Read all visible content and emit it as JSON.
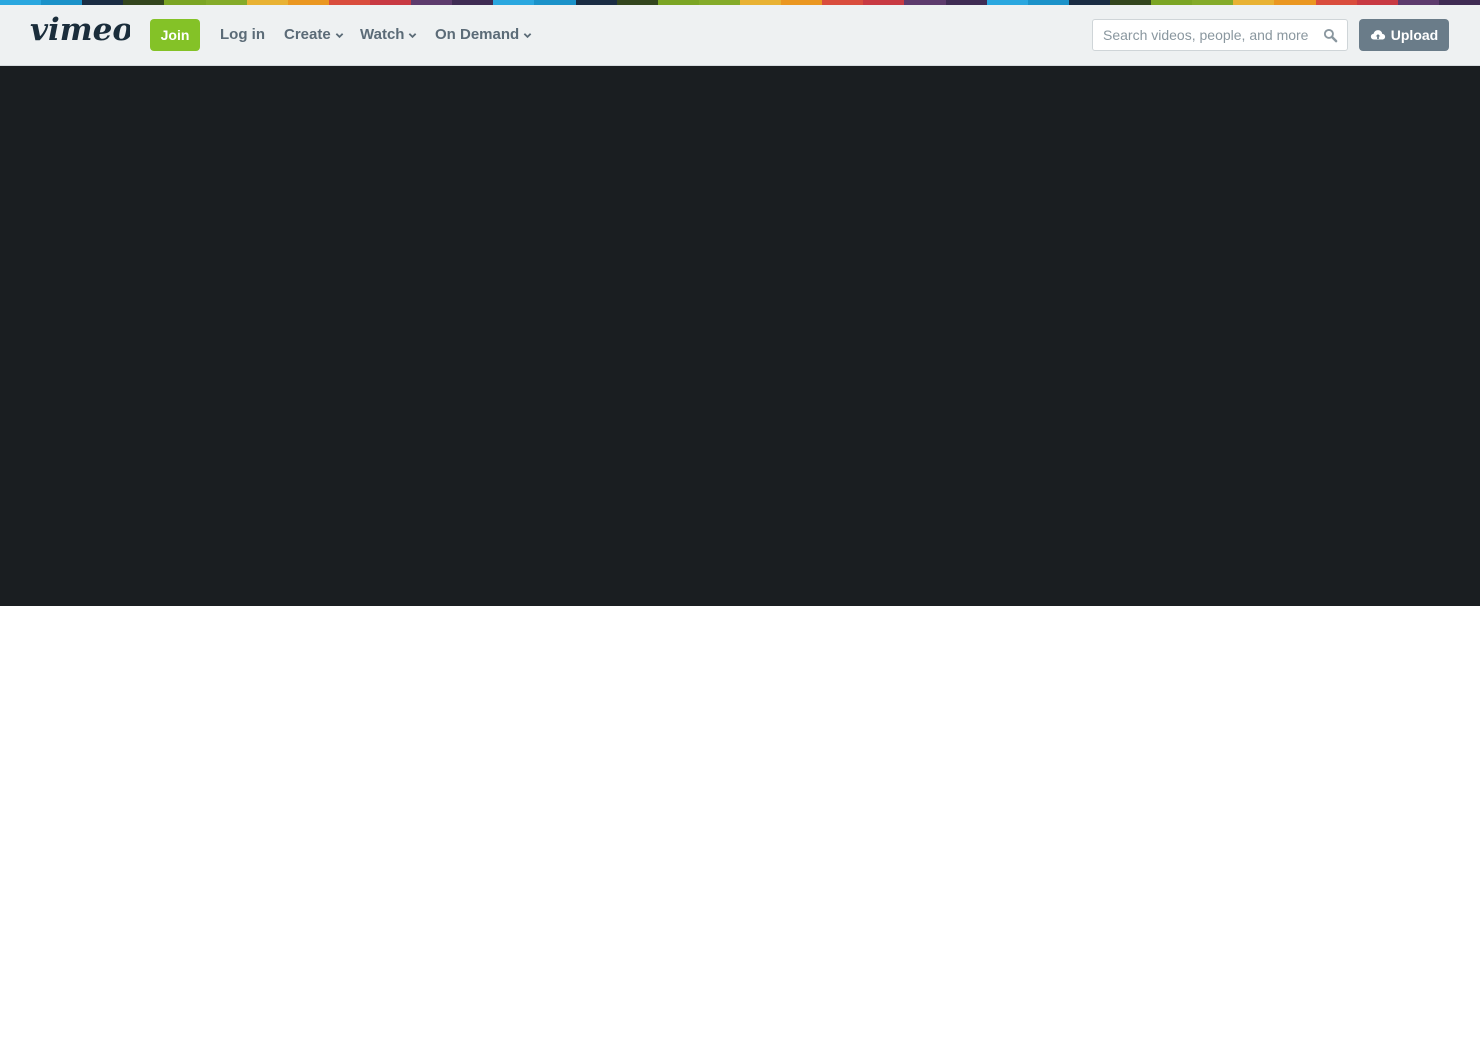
{
  "brand": {
    "logo_text": "vimeo",
    "stripe_colors": [
      "#2aa7df",
      "#1b92c9",
      "#1a2d44",
      "#33461e",
      "#7ba524",
      "#84ab2a",
      "#e8b234",
      "#ea9721",
      "#d94d3d",
      "#c83a43",
      "#5d3b6d",
      "#3f2c54",
      "#2aa7df",
      "#1b92c9",
      "#1a2d44",
      "#33461e",
      "#7ba524",
      "#84ab2a",
      "#e8b234",
      "#ea9721",
      "#d94d3d",
      "#c83a43",
      "#5d3b6d",
      "#3f2c54",
      "#2aa7df",
      "#1b92c9",
      "#1a2d44",
      "#33461e",
      "#7ba524",
      "#84ab2a",
      "#e8b234",
      "#ea9721",
      "#d94d3d",
      "#c83a43",
      "#5d3b6d",
      "#3f2c54"
    ]
  },
  "topnav": {
    "join_label": "Join",
    "login_label": "Log in",
    "create_label": "Create",
    "watch_label": "Watch",
    "ondemand_label": "On Demand",
    "search_placeholder": "Search videos, people, and more",
    "search_value": "",
    "upload_label": "Upload"
  },
  "colors": {
    "join_green": "#84c227",
    "nav_bg": "#eef1f2",
    "nav_text": "#5b6b77",
    "upload_bg": "#6a7c89",
    "player_bg": "#1a1e21"
  },
  "icons": {
    "search": "search-icon",
    "chevron": "chevron-down-icon",
    "upload": "cloud-upload-icon"
  }
}
